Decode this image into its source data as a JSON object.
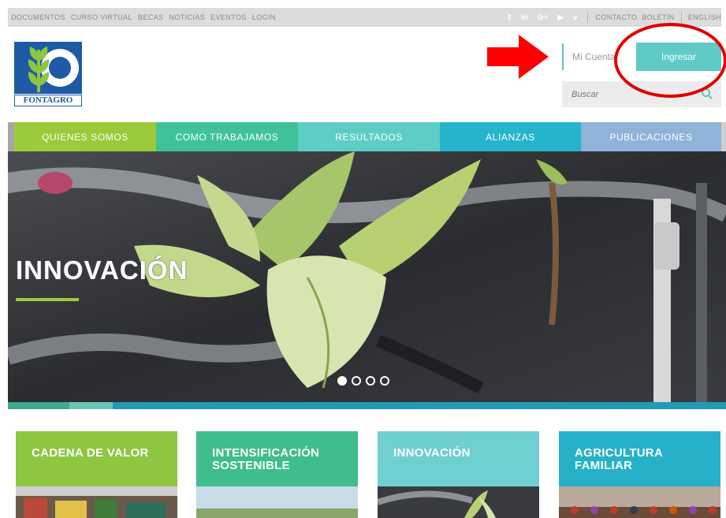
{
  "topbar": {
    "links_left": [
      "DOCUMENTOS",
      "CURSO VIRTUAL",
      "BECAS",
      "NOTICIAS",
      "EVENTOS",
      "LOGIN"
    ],
    "social": [
      "twitter-icon",
      "linkedin-icon",
      "google-plus-icon",
      "youtube-icon",
      "vimeo-icon"
    ],
    "social_glyphs": [
      "𝕥",
      "in",
      "G+",
      "▶",
      "v"
    ],
    "links_right": [
      "CONTACTO",
      "BOLETÍN",
      "ENGLISH"
    ]
  },
  "logo": {
    "text": "FONTAGRO"
  },
  "account": {
    "label": "Mi Cuenta",
    "login_button": "Ingresar"
  },
  "search": {
    "placeholder": "Buscar"
  },
  "nav": {
    "items": [
      "QUIENES SOMOS",
      "COMO TRABAJAMOS",
      "RESULTADOS",
      "ALIANZAS",
      "PUBLICACIONES"
    ]
  },
  "hero": {
    "title": "INNOVACIÓN",
    "slide_count": 4,
    "active_slide": 1
  },
  "cards": [
    {
      "title": "CADENA DE VALOR"
    },
    {
      "title": "INTENSIFICACIÓN SOSTENIBLE"
    },
    {
      "title": "INNOVACIÓN"
    },
    {
      "title": "AGRICULTURA FAMILIAR"
    }
  ],
  "colors": {
    "green": "#9bcb3c",
    "teal": "#3fc29a",
    "aqua": "#5ecdc6",
    "blue": "#24b4cc",
    "lightblue": "#8fb3d9",
    "logo_blue": "#1f5aa6",
    "annotation_red": "#e00000"
  }
}
